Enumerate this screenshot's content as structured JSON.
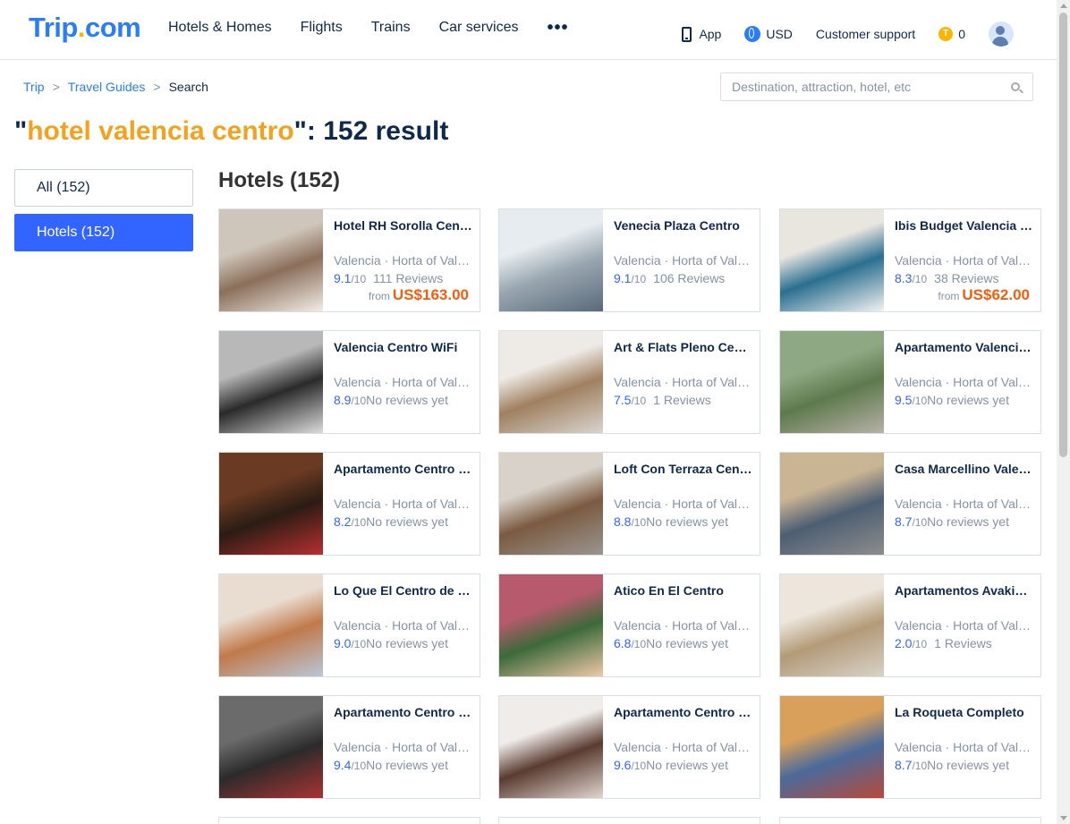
{
  "header": {
    "logo_part1": "Trip",
    "logo_part2": ".",
    "logo_part3": "com",
    "nav": [
      "Hotels & Homes",
      "Flights",
      "Trains",
      "Car services"
    ],
    "more": "•••",
    "app": "App",
    "currency": "USD",
    "support": "Customer support",
    "coin_symbol": "T",
    "coins": "0"
  },
  "breadcrumb": {
    "items": [
      "Trip",
      "Travel Guides",
      "Search"
    ],
    "sep": ">"
  },
  "search": {
    "placeholder": "Destination, attraction, hotel, etc"
  },
  "result": {
    "quote_open": "\"",
    "keyword": "hotel valencia centro",
    "suffix": "\": 152 result"
  },
  "sidebar": {
    "all": "All (152)",
    "hotels": "Hotels (152)"
  },
  "section_title": "Hotels (152)",
  "hotels": [
    {
      "name": "Hotel RH Sorolla Centro",
      "loc": "Valencia · Horta of Valencia",
      "score": "9.1",
      "den": "/10",
      "reviews": "111 Reviews",
      "from": "from",
      "price": "US$163.00",
      "img": [
        "#cfc6bb",
        "#8b6f5a",
        "#f1ede8"
      ]
    },
    {
      "name": "Venecia Plaza Centro",
      "loc": "Valencia · Horta of Valencia",
      "score": "9.1",
      "den": "/10",
      "reviews": "106 Reviews",
      "from": "",
      "price": "",
      "img": [
        "#e6ecef",
        "#9aa7b1",
        "#5a6a7a"
      ]
    },
    {
      "name": "Ibis Budget Valencia Centro",
      "loc": "Valencia · Horta of Valencia",
      "score": "8.3",
      "den": "/10",
      "reviews": "38 Reviews",
      "from": "from",
      "price": "US$62.00",
      "img": [
        "#e9e6e0",
        "#2a6f8f",
        "#f2f2f2"
      ]
    },
    {
      "name": "Valencia Centro WiFi",
      "loc": "Valencia · Horta of Valencia",
      "score": "8.9",
      "den": "/10",
      "reviews": "No reviews yet",
      "from": "",
      "price": "",
      "img": [
        "#b8b8b8",
        "#2a2a2a",
        "#dcdcdc"
      ]
    },
    {
      "name": "Art & Flats Pleno Centro",
      "loc": "Valencia · Horta of Valencia",
      "score": "7.5",
      "den": "/10",
      "reviews": "1 Reviews",
      "from": "",
      "price": "",
      "img": [
        "#eeeae6",
        "#a08060",
        "#d9d4cf"
      ]
    },
    {
      "name": "Apartamento Valencia Centro",
      "loc": "Valencia · Horta of Valencia",
      "score": "9.5",
      "den": "/10",
      "reviews": "No reviews yet",
      "from": "",
      "price": "",
      "img": [
        "#8fa884",
        "#5d7a4c",
        "#b7b1a8"
      ]
    },
    {
      "name": "Apartamento Centro Valencia",
      "loc": "Valencia · Horta of Valencia",
      "score": "8.2",
      "den": "/10",
      "reviews": "No reviews yet",
      "from": "",
      "price": "",
      "img": [
        "#6a3a22",
        "#2b1c14",
        "#b63030"
      ]
    },
    {
      "name": "Loft Con Terraza Centro",
      "loc": "Valencia · Horta of Valencia",
      "score": "8.8",
      "den": "/10",
      "reviews": "No reviews yet",
      "from": "",
      "price": "",
      "img": [
        "#d8d2ca",
        "#7b5a40",
        "#9a9691"
      ]
    },
    {
      "name": "Casa Marcellino Valencia",
      "loc": "Valencia · Horta of Valencia",
      "score": "8.7",
      "den": "/10",
      "reviews": "No reviews yet",
      "from": "",
      "price": "",
      "img": [
        "#c9b493",
        "#4d5e72",
        "#8d8d8d"
      ]
    },
    {
      "name": "Lo Que El Centro de Valencia",
      "loc": "Valencia · Horta of Valencia",
      "score": "9.0",
      "den": "/10",
      "reviews": "No reviews yet",
      "from": "",
      "price": "",
      "img": [
        "#e8ddd0",
        "#c07a4a",
        "#b9c7d8"
      ]
    },
    {
      "name": "Atico En El Centro",
      "loc": "Valencia · Horta of Valencia",
      "score": "6.8",
      "den": "/10",
      "reviews": "No reviews yet",
      "from": "",
      "price": "",
      "img": [
        "#b85a6e",
        "#3c6a3a",
        "#efc9a8"
      ]
    },
    {
      "name": "Apartamentos Avakin Centro",
      "loc": "Valencia · Horta of Valencia",
      "score": "2.0",
      "den": "/10",
      "reviews": "1 Reviews",
      "from": "",
      "price": "",
      "img": [
        "#ece6dc",
        "#b39a78",
        "#d8d2c8"
      ]
    },
    {
      "name": "Apartamento Centro Ciudad",
      "loc": "Valencia · Horta of Valencia",
      "score": "9.4",
      "den": "/10",
      "reviews": "No reviews yet",
      "from": "",
      "price": "",
      "img": [
        "#6b6b6b",
        "#2b2b2b",
        "#a33"
      ]
    },
    {
      "name": "Apartamento Centro Historico",
      "loc": "Valencia · Horta of Valencia",
      "score": "9.6",
      "den": "/10",
      "reviews": "No reviews yet",
      "from": "",
      "price": "",
      "img": [
        "#f0ecea",
        "#5a3b30",
        "#e0d6d0"
      ]
    },
    {
      "name": "La Roqueta Completo",
      "loc": "Valencia · Horta of Valencia",
      "score": "8.7",
      "den": "/10",
      "reviews": "No reviews yet",
      "from": "",
      "price": "",
      "img": [
        "#d8a05a",
        "#4a6a9a",
        "#b84a3a"
      ]
    }
  ]
}
